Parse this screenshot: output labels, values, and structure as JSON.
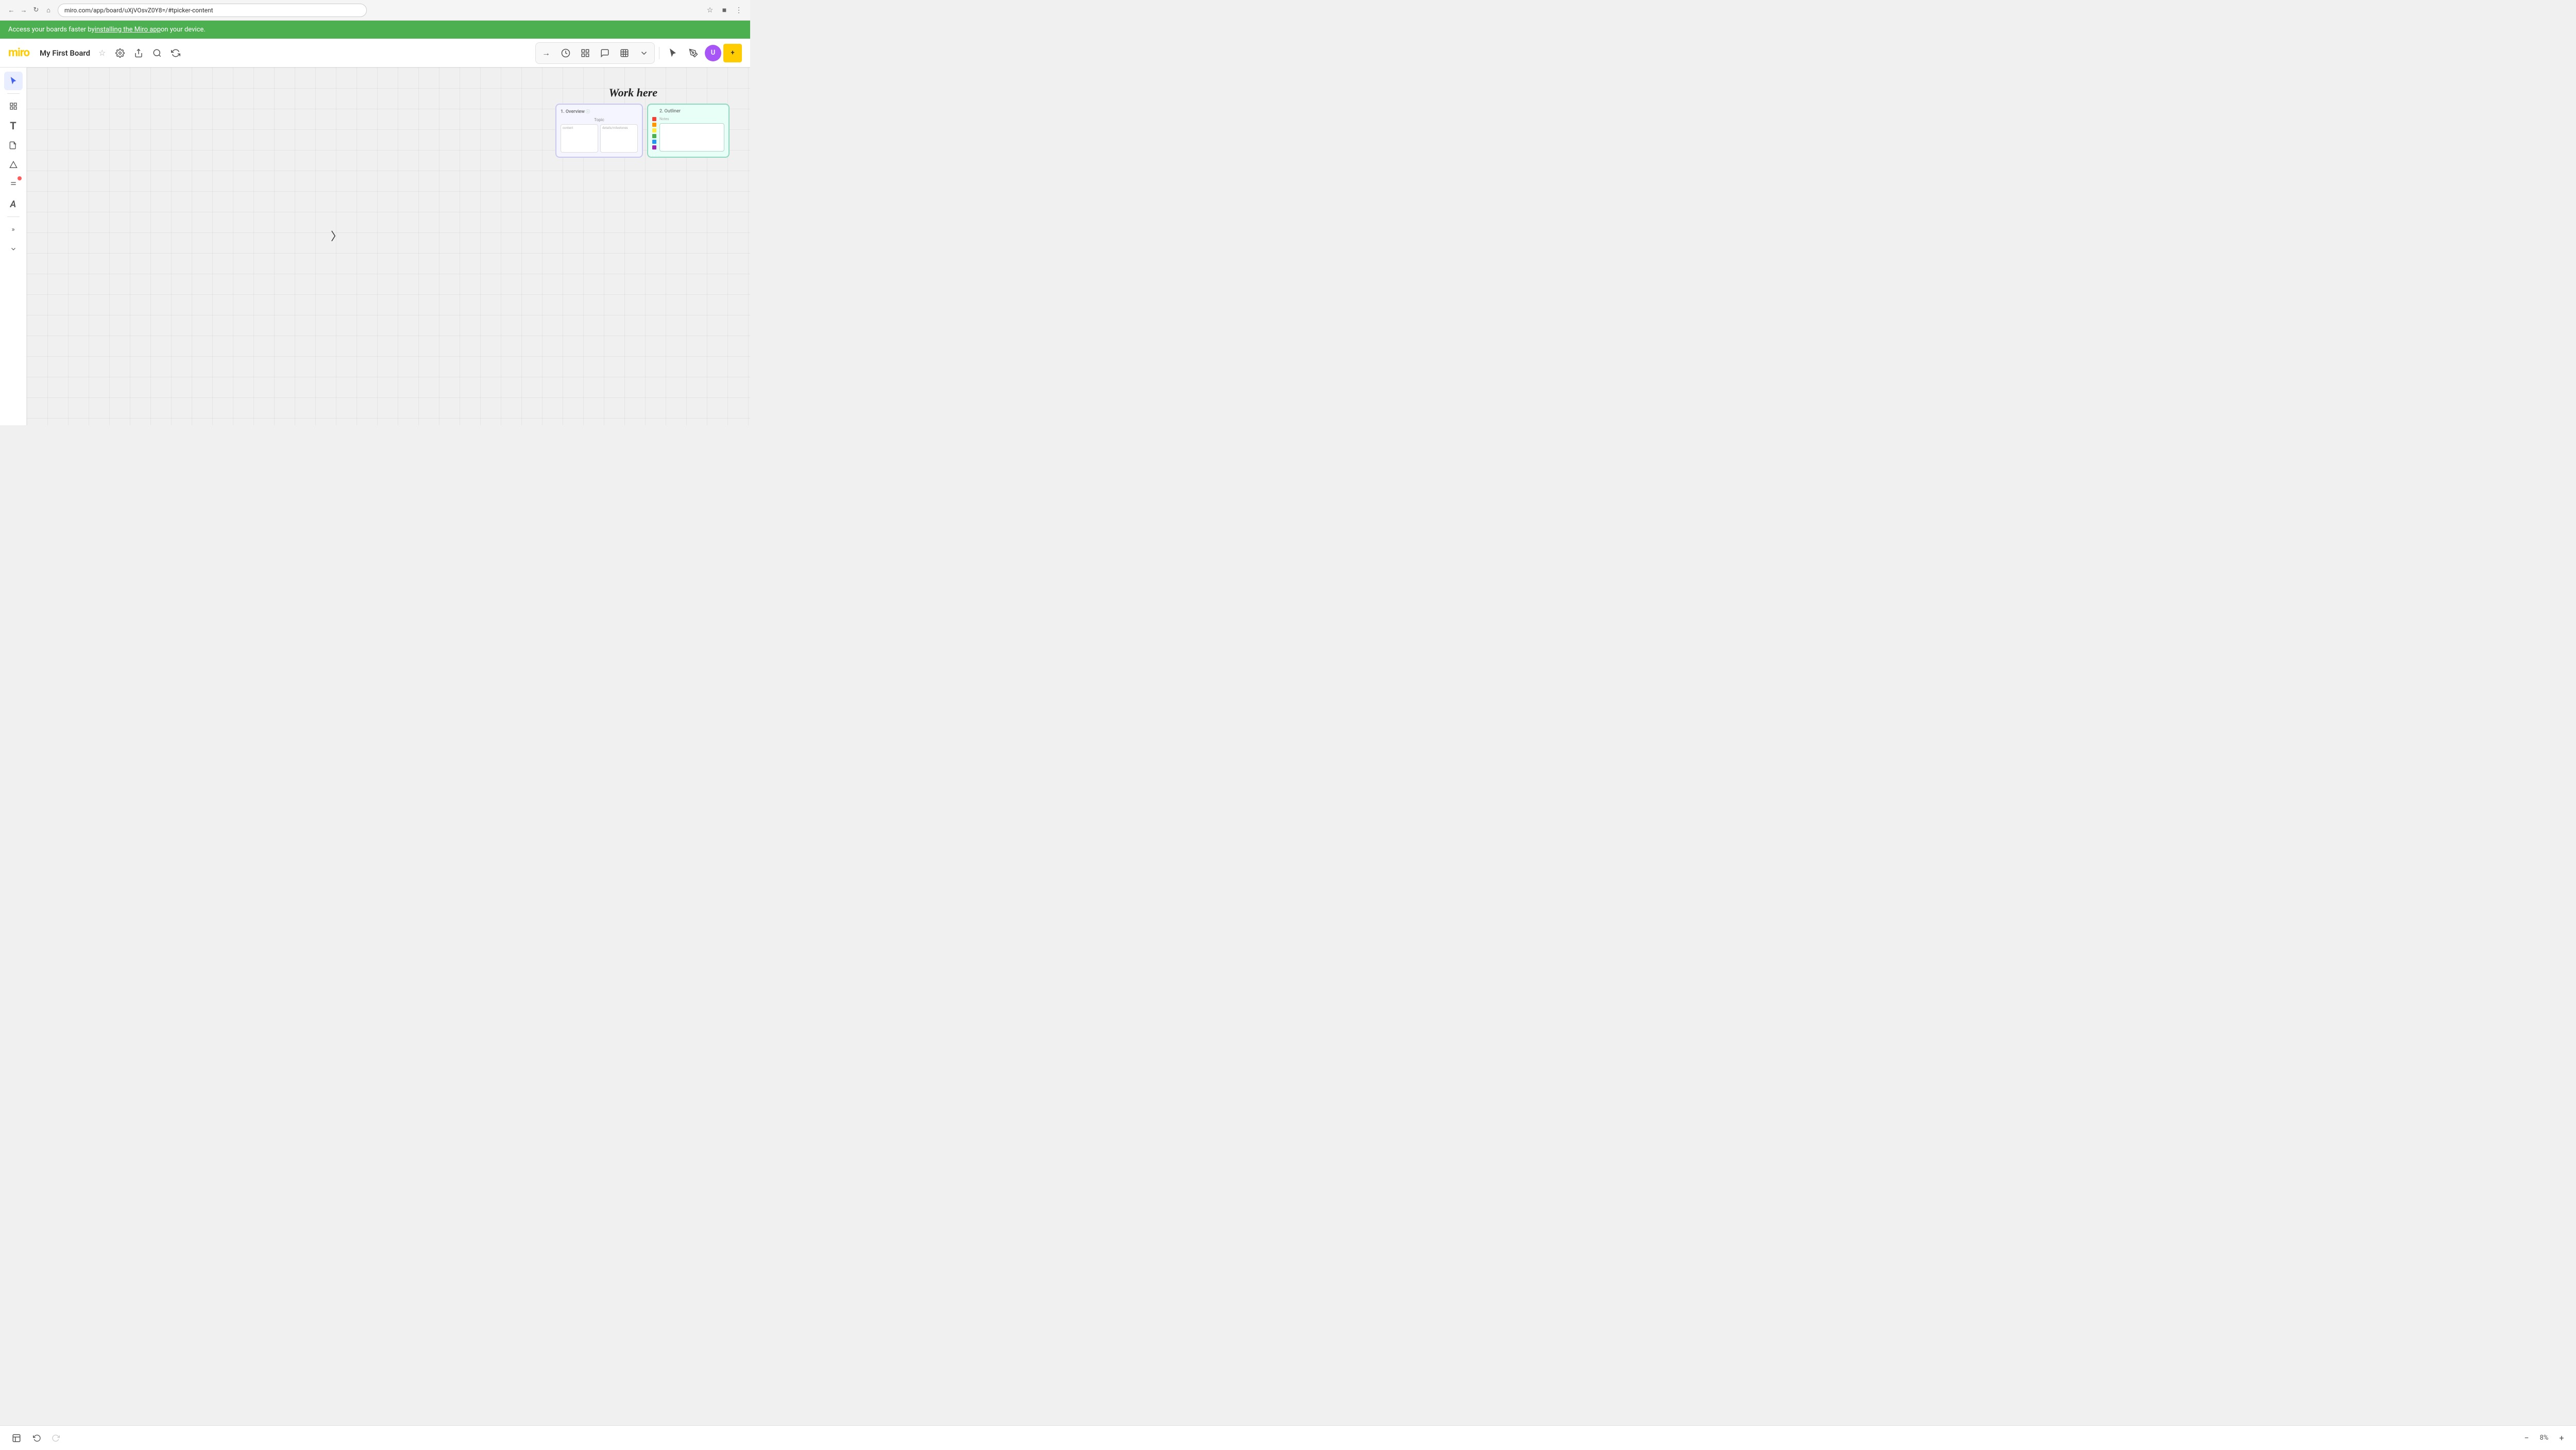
{
  "browser": {
    "url": "miro.com/app/board/uXjVOsvZ0Y8=/#tpicker-content",
    "back_title": "back",
    "forward_title": "forward",
    "refresh_title": "refresh",
    "home_title": "home"
  },
  "banner": {
    "text": "Access your boards faster by ",
    "link_text": "installing the Miro app",
    "text_after": " on your device."
  },
  "app_bar": {
    "logo": "miro",
    "board_title": "My First Board",
    "settings_icon": "settings",
    "share_icon": "share",
    "search_icon": "search",
    "integrations_icon": "integrations"
  },
  "right_toolbar": {
    "arrow_icon": "arrow",
    "timer_icon": "timer",
    "frames_icon": "frames",
    "comment_icon": "comment",
    "table_icon": "table",
    "more_icon": "more",
    "cursor_icon": "cursor",
    "pen_icon": "pen",
    "avatar_initials": "U",
    "avatar_color": "#a855f7"
  },
  "left_toolbar": {
    "select_icon": "cursor/select",
    "frames_icon": "frames/grid",
    "text_icon": "text",
    "sticky_icon": "sticky-note",
    "shapes_icon": "shapes",
    "pen_icon": "pen/draw",
    "letter_icon": "letter-a",
    "more_icon": "more/double-arrow",
    "expand_icon": "expand/chevron"
  },
  "canvas": {
    "work_here_label": "Work here",
    "frames": [
      {
        "id": "frame-1",
        "label": "1. Overview",
        "topic_label": "Topic",
        "boxes": [
          {
            "label": "content"
          },
          {
            "label": "details/milestones"
          }
        ]
      }
    ],
    "outliner": {
      "label": "2. Outliner",
      "header": "Notes",
      "colors": [
        "#f44336",
        "#ff9800",
        "#ffeb3b",
        "#4caf50",
        "#2196f3",
        "#9c27b0"
      ]
    }
  },
  "bottom_toolbar": {
    "pages_icon": "pages",
    "undo_icon": "undo",
    "redo_icon": "redo",
    "zoom_minus": "−",
    "zoom_plus": "+",
    "zoom_level": "8%"
  }
}
